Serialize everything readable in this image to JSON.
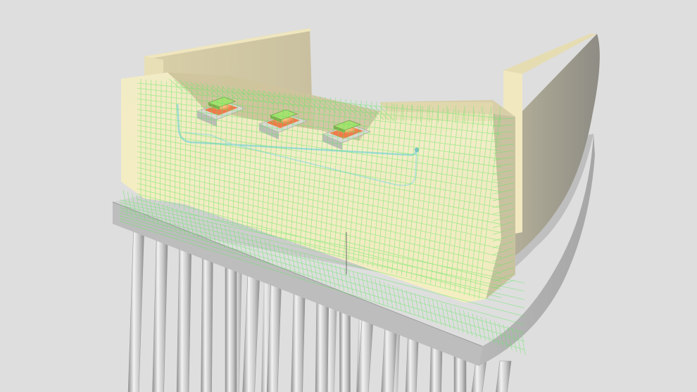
{
  "viewport": {
    "background": "#dedede"
  },
  "model": {
    "pile_count": 17,
    "bearing_count": 3,
    "colors": {
      "pile": "#c8c8c8",
      "pile_cap": "#c6c6c6",
      "wall": "#ece2b4",
      "wall_side": "#c6c0a0",
      "rebar": "#5fe85f",
      "duct": "#8fd7d7",
      "bearing_pad": "#f07a4a",
      "bearing_plate": "#a8e070"
    }
  }
}
